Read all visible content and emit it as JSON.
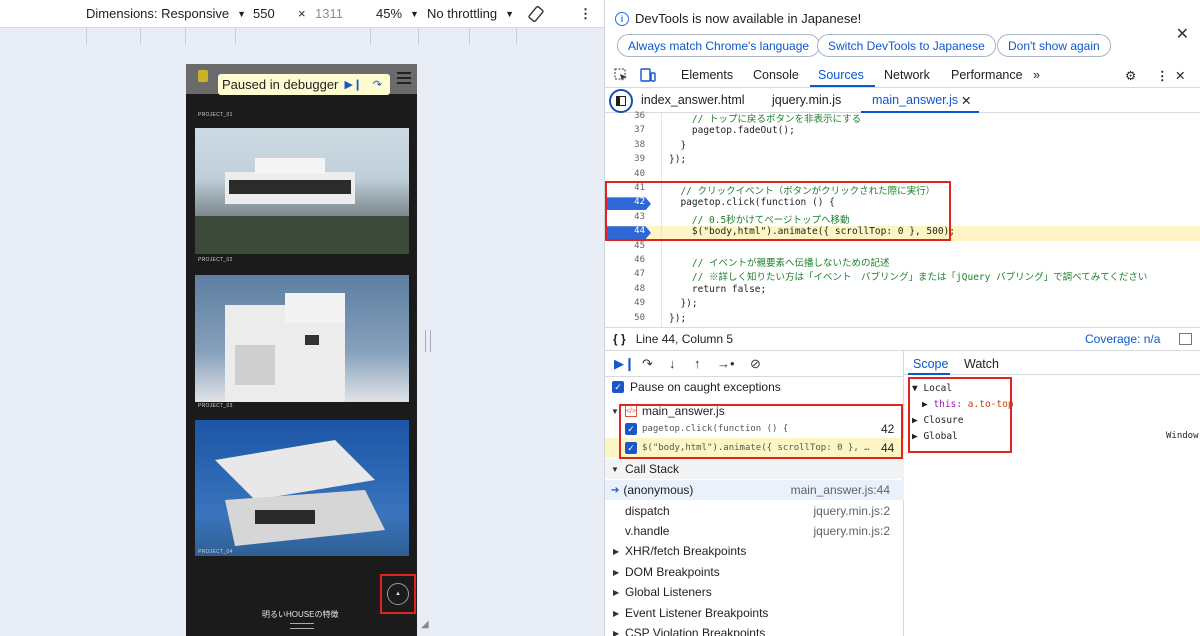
{
  "device_toolbar": {
    "dimensions_label": "Dimensions: Responsive",
    "width_value": "550",
    "times": "×",
    "height_value": "1311",
    "zoom": "45%",
    "throttling": "No throttling"
  },
  "device_page": {
    "paused_label": "Paused in debugger",
    "projects": [
      "PROJECT_01",
      "PROJECT_02",
      "PROJECT_03",
      "PROJECT_04"
    ],
    "footer_heading": "明るいHOUSEの特徴"
  },
  "devtools": {
    "banner": {
      "message": "DevTools is now available in Japanese!",
      "btn_match": "Always match Chrome's language",
      "btn_switch": "Switch DevTools to Japanese",
      "btn_dont_show": "Don't show again"
    },
    "tabs": [
      "Elements",
      "Console",
      "Sources",
      "Network",
      "Performance"
    ],
    "file_tabs": [
      "index_answer.html",
      "jquery.min.js",
      "main_answer.js"
    ],
    "code_lines": [
      {
        "n": "36",
        "t": "    // トップに戻るボタンを非表示にする"
      },
      {
        "n": "37",
        "t": "    pagetop.fadeOut();"
      },
      {
        "n": "38",
        "t": "  }"
      },
      {
        "n": "39",
        "t": "});"
      },
      {
        "n": "40",
        "t": ""
      },
      {
        "n": "41",
        "t": "  // クリックイベント（ボタンがクリックされた際に実行）"
      },
      {
        "n": "42",
        "t": "  pagetop.click(function () {"
      },
      {
        "n": "43",
        "t": "    // 0.5秒かけてページトップへ移動"
      },
      {
        "n": "44",
        "t": "    $(\"body,html\").animate({ scrollTop: 0 }, 500);"
      },
      {
        "n": "45",
        "t": ""
      },
      {
        "n": "46",
        "t": "    // イベントが親要素へ伝播しないための記述"
      },
      {
        "n": "47",
        "t": "    // ※詳しく知りたい方は「イベント　バブリング」または「jQuery バブリング」で調べてみてください"
      },
      {
        "n": "48",
        "t": "    return false;"
      },
      {
        "n": "49",
        "t": "  });"
      },
      {
        "n": "50",
        "t": "});"
      }
    ],
    "status": {
      "position": "Line 44, Column 5",
      "coverage": "Coverage: n/a"
    },
    "debugger": {
      "pause_caught": "Pause on caught exceptions",
      "bp_file": "main_answer.js",
      "bp1_code": "pagetop.click(function () {",
      "bp1_line": "42",
      "bp2_code": "$(\"body,html\").animate({ scrollTop: 0 }, …",
      "bp2_line": "44",
      "call_stack": "Call Stack",
      "frames": [
        {
          "name": "(anonymous)",
          "loc": "main_answer.js:44"
        },
        {
          "name": "dispatch",
          "loc": "jquery.min.js:2"
        },
        {
          "name": "v.handle",
          "loc": "jquery.min.js:2"
        }
      ],
      "sections": [
        "XHR/fetch Breakpoints",
        "DOM Breakpoints",
        "Global Listeners",
        "Event Listener Breakpoints",
        "CSP Violation Breakpoints"
      ]
    },
    "scope": {
      "tab_scope": "Scope",
      "tab_watch": "Watch",
      "local": "Local",
      "this_key": "this:",
      "this_val": "a.to-top",
      "closure": "Closure",
      "global": "Global",
      "global_val": "Window"
    }
  }
}
